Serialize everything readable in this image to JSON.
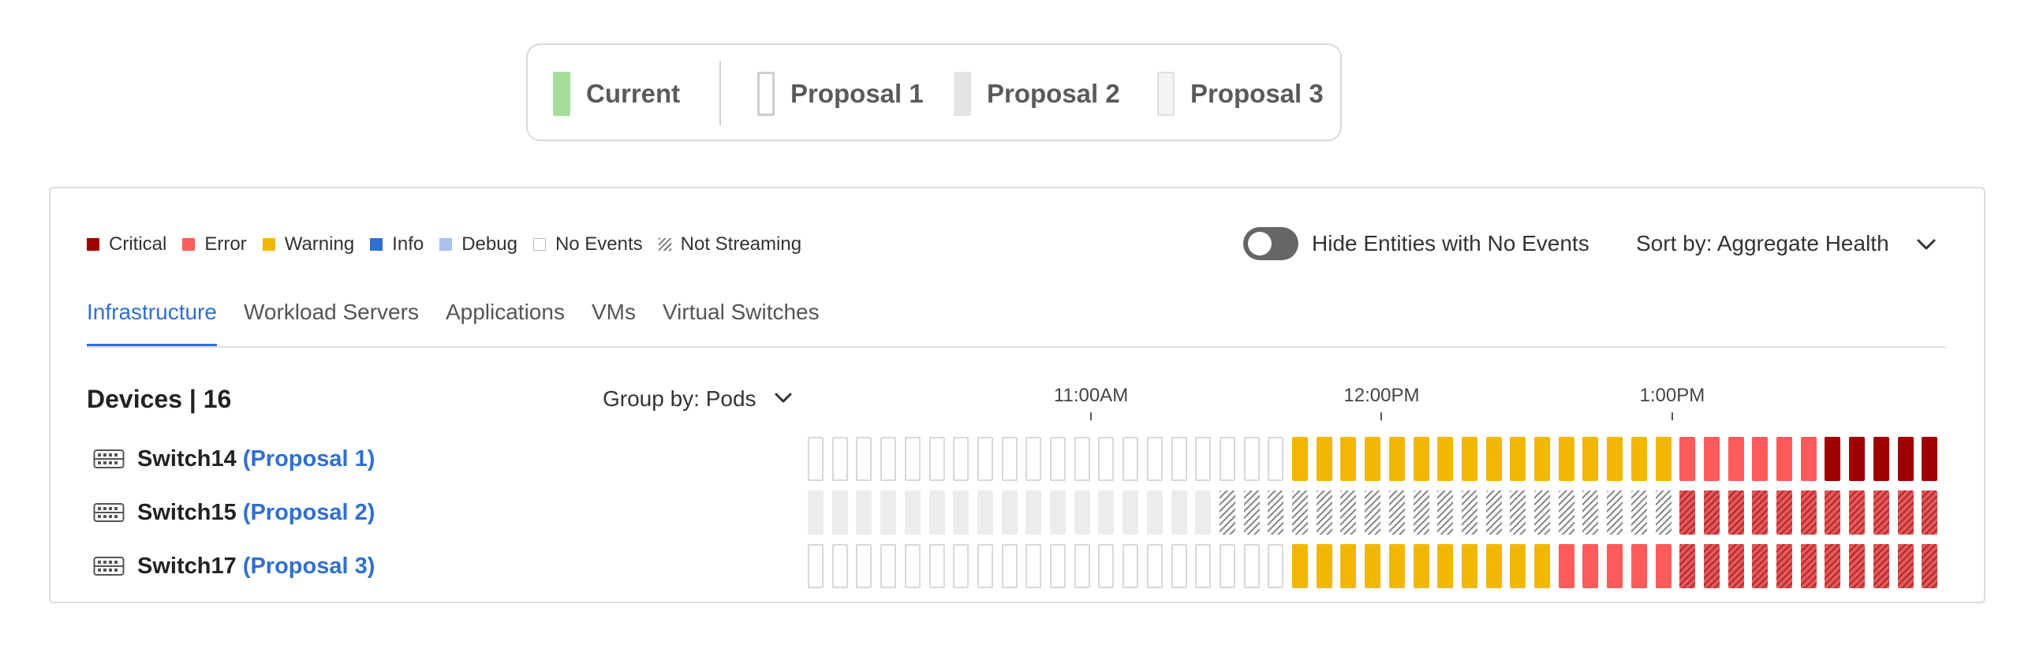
{
  "proposal_legend": [
    {
      "label": "Current",
      "swatch": "solid-green"
    },
    {
      "label": "Proposal 1",
      "swatch": "outline"
    },
    {
      "label": "Proposal 2",
      "swatch": "light-gray"
    },
    {
      "label": "Proposal 3",
      "swatch": "outline-light"
    }
  ],
  "event_legend": [
    {
      "label": "Critical",
      "color": "#a00000"
    },
    {
      "label": "Error",
      "color": "#ff5b5b"
    },
    {
      "label": "Warning",
      "color": "#f2b705"
    },
    {
      "label": "Info",
      "color": "#2f6fd0"
    },
    {
      "label": "Debug",
      "color": "#a9c2ee"
    },
    {
      "label": "No Events",
      "color": "#ffffff"
    },
    {
      "label": "Not Streaming",
      "color": "hatched"
    }
  ],
  "controls": {
    "hide_toggle_label": "Hide Entities with No Events",
    "hide_toggle_on": false,
    "sort_label": "Sort by: Aggregate Health"
  },
  "tabs": [
    {
      "label": "Infrastructure",
      "active": true
    },
    {
      "label": "Workload Servers",
      "active": false
    },
    {
      "label": "Applications",
      "active": false
    },
    {
      "label": "VMs",
      "active": false
    },
    {
      "label": "Virtual Switches",
      "active": false
    }
  ],
  "devices": {
    "title": "Devices | 16",
    "group_by": "Group by: Pods"
  },
  "timeline": {
    "labels": [
      "11:00AM",
      "12:00PM",
      "1:00PM"
    ],
    "label_slots": [
      11.5,
      23.5,
      35.5
    ]
  },
  "rows": [
    {
      "name": "Switch14",
      "proposal": "(Proposal 1)",
      "segments": [
        [
          "empty",
          20
        ],
        [
          "warning",
          16
        ],
        [
          "error",
          6
        ],
        [
          "critical",
          5
        ]
      ]
    },
    {
      "name": "Switch15",
      "proposal": "(Proposal 2)",
      "segments": [
        [
          "gray",
          17
        ],
        [
          "not-streaming",
          19
        ],
        [
          "error-hatched",
          11
        ]
      ]
    },
    {
      "name": "Switch17",
      "proposal": "(Proposal 3)",
      "segments": [
        [
          "empty",
          20
        ],
        [
          "warning",
          11
        ],
        [
          "error",
          5
        ],
        [
          "error-hatched",
          11
        ]
      ]
    }
  ],
  "colors": {
    "accent": "#2f6fd0",
    "current": "#a4dd9a",
    "proposal_outline": "#cccccc",
    "proposal_gray": "#e3e3e3"
  }
}
